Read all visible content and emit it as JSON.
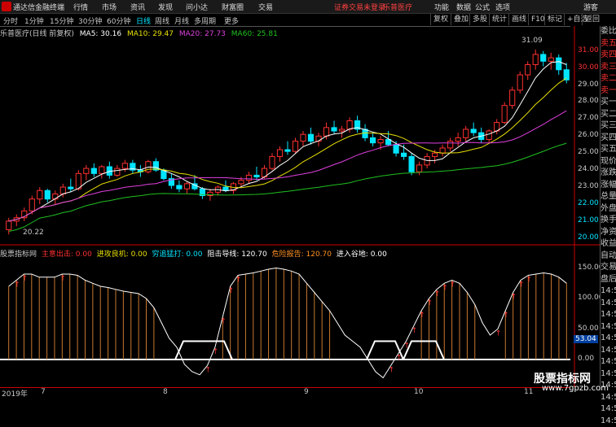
{
  "menubar": {
    "app": "通达信金融终端",
    "menus": [
      "行情",
      "市场",
      "资讯",
      "发现",
      "问小达",
      "财富圈",
      "交易"
    ],
    "notice": "证券交易未登录",
    "stock": "乐普医疗",
    "right": [
      "功能",
      "数据",
      "公式",
      "选项",
      "游客"
    ]
  },
  "period_tabs": [
    "分时",
    "1分钟",
    "15分钟",
    "30分钟",
    "60分钟",
    "日线",
    "周线",
    "月线",
    "多周期",
    "更多"
  ],
  "toolbar_buttons": [
    "复权",
    "叠加",
    "多股",
    "统计",
    "画线",
    "F10",
    "标记",
    "+自选",
    "返回"
  ],
  "ma_header": {
    "title": "乐普医疗(日线 前复权)",
    "ma5": "MA5: 30.16",
    "ma10": "MA10: 29.47",
    "ma20": "MA20: 27.73",
    "ma60": "MA60: 25.81"
  },
  "price_axis": [
    "31.00",
    "30.00",
    "29.00",
    "28.00",
    "27.00",
    "26.00",
    "25.00",
    "24.00",
    "23.00",
    "22.00",
    "21.00",
    "20.00"
  ],
  "price_annotations": {
    "high": "31.09",
    "low": "20.22"
  },
  "indicator_header": {
    "title": "股票指标网",
    "i1": "主意出击: 0.00",
    "i2": "进攻良机: 0.00",
    "i3": "穷追猛打: 0.00",
    "i4": "阻击导线: 120.70",
    "i5": "危险报告: 120.70",
    "i6": "进入谷地: 0.00"
  },
  "indicator_axis": [
    "150.00",
    "100.00",
    "50.00",
    "0.00"
  ],
  "indicator_current": "53.04",
  "side_panel": [
    "委比",
    "卖五",
    "卖四",
    "卖三",
    "卖二",
    "卖一",
    "买一",
    "买二",
    "买三",
    "买四",
    "买五",
    "现价",
    "涨跌",
    "涨幅",
    "总量",
    "外盘",
    "换手",
    "净资",
    "收益",
    "自动",
    "交易",
    "盘后",
    "14:56",
    "14:56",
    "14:56",
    "14:56",
    "14:56",
    "14:56",
    "14:56",
    "14:56",
    "14:57",
    "14:57",
    "14:57",
    "14:57"
  ],
  "date_axis": [
    "2019年",
    "7",
    "8",
    "9",
    "10",
    "11"
  ],
  "watermark": {
    "t1": "股票指标网",
    "t2": "www.7gpzb.com"
  },
  "colors": {
    "up": "#ff3030",
    "down": "#00e5ff",
    "ma5": "#ffffff",
    "ma10": "#e8e000",
    "ma20": "#e040e0",
    "ma60": "#20c020"
  },
  "chart_data": {
    "type": "candlestick",
    "ohlc": [
      [
        20.5,
        21.2,
        20.22,
        21.0
      ],
      [
        21.0,
        21.4,
        20.7,
        21.2
      ],
      [
        21.2,
        21.8,
        21.0,
        21.6
      ],
      [
        21.6,
        22.5,
        21.4,
        22.3
      ],
      [
        22.3,
        23.0,
        22.0,
        22.8
      ],
      [
        22.8,
        22.9,
        22.1,
        22.3
      ],
      [
        22.3,
        22.8,
        22.0,
        22.6
      ],
      [
        22.6,
        23.2,
        22.4,
        23.0
      ],
      [
        23.0,
        23.5,
        22.7,
        22.9
      ],
      [
        22.9,
        24.0,
        22.8,
        23.8
      ],
      [
        23.8,
        24.3,
        23.4,
        24.1
      ],
      [
        24.1,
        24.4,
        23.6,
        23.8
      ],
      [
        23.8,
        24.3,
        23.5,
        24.2
      ],
      [
        24.2,
        24.5,
        23.5,
        23.7
      ],
      [
        23.7,
        24.3,
        23.6,
        24.1
      ],
      [
        24.1,
        24.6,
        23.9,
        24.4
      ],
      [
        24.4,
        24.6,
        23.8,
        24.0
      ],
      [
        24.0,
        24.3,
        23.6,
        23.9
      ],
      [
        23.9,
        24.6,
        23.8,
        24.5
      ],
      [
        24.5,
        24.7,
        23.9,
        24.0
      ],
      [
        24.0,
        24.1,
        23.4,
        23.5
      ],
      [
        23.5,
        23.8,
        22.9,
        23.1
      ],
      [
        23.1,
        23.4,
        22.7,
        22.9
      ],
      [
        22.9,
        23.3,
        22.6,
        23.2
      ],
      [
        23.2,
        23.7,
        22.8,
        22.9
      ],
      [
        22.9,
        23.0,
        22.3,
        22.5
      ],
      [
        22.5,
        22.9,
        22.2,
        22.7
      ],
      [
        22.7,
        23.1,
        22.5,
        23.0
      ],
      [
        23.0,
        23.4,
        22.7,
        22.8
      ],
      [
        22.8,
        23.3,
        22.6,
        23.2
      ],
      [
        23.2,
        23.6,
        23.0,
        23.4
      ],
      [
        23.4,
        23.9,
        23.2,
        23.7
      ],
      [
        23.7,
        24.2,
        23.4,
        23.6
      ],
      [
        23.6,
        24.3,
        23.5,
        24.1
      ],
      [
        24.1,
        25.0,
        24.0,
        24.8
      ],
      [
        24.8,
        25.4,
        24.5,
        25.2
      ],
      [
        25.2,
        25.7,
        24.9,
        25.1
      ],
      [
        25.1,
        25.9,
        25.0,
        25.7
      ],
      [
        25.7,
        26.3,
        25.4,
        26.1
      ],
      [
        26.1,
        26.5,
        25.5,
        25.7
      ],
      [
        25.7,
        26.2,
        25.4,
        26.0
      ],
      [
        26.0,
        26.8,
        25.8,
        26.5
      ],
      [
        26.5,
        26.9,
        26.1,
        26.3
      ],
      [
        26.3,
        26.6,
        25.9,
        26.4
      ],
      [
        26.4,
        27.1,
        26.2,
        26.9
      ],
      [
        26.9,
        27.2,
        26.2,
        26.4
      ],
      [
        26.4,
        26.7,
        25.7,
        25.9
      ],
      [
        25.9,
        26.2,
        25.4,
        25.6
      ],
      [
        25.6,
        26.0,
        25.2,
        25.8
      ],
      [
        25.8,
        26.3,
        25.4,
        25.5
      ],
      [
        25.5,
        25.7,
        24.8,
        25.0
      ],
      [
        25.0,
        25.5,
        24.6,
        24.8
      ],
      [
        24.8,
        25.0,
        23.7,
        23.9
      ],
      [
        23.9,
        24.5,
        23.7,
        24.3
      ],
      [
        24.3,
        25.0,
        24.1,
        24.8
      ],
      [
        24.8,
        25.2,
        24.4,
        25.0
      ],
      [
        25.0,
        25.5,
        24.8,
        25.3
      ],
      [
        25.3,
        25.9,
        25.1,
        25.7
      ],
      [
        25.7,
        26.2,
        25.4,
        25.9
      ],
      [
        25.9,
        26.6,
        25.7,
        26.4
      ],
      [
        26.4,
        26.8,
        26.0,
        26.2
      ],
      [
        26.2,
        26.5,
        25.6,
        25.8
      ],
      [
        25.8,
        26.4,
        25.6,
        26.3
      ],
      [
        26.3,
        27.0,
        26.1,
        26.8
      ],
      [
        26.8,
        28.0,
        26.7,
        27.8
      ],
      [
        27.8,
        28.9,
        27.6,
        28.7
      ],
      [
        28.7,
        29.8,
        28.5,
        29.6
      ],
      [
        29.6,
        30.4,
        29.3,
        30.2
      ],
      [
        30.2,
        31.09,
        29.9,
        30.8
      ],
      [
        30.8,
        31.0,
        30.1,
        30.4
      ],
      [
        30.4,
        30.9,
        29.9,
        30.6
      ],
      [
        30.6,
        30.8,
        29.6,
        29.9
      ],
      [
        29.9,
        30.3,
        29.1,
        29.3
      ]
    ],
    "ma5": [
      30.16
    ],
    "ma10": [
      29.47
    ],
    "ma20": [
      27.73
    ],
    "ma60": [
      25.81
    ],
    "indicator": [
      120,
      130,
      140,
      140,
      135,
      135,
      135,
      140,
      140,
      138,
      130,
      125,
      120,
      118,
      115,
      112,
      110,
      108,
      100,
      85,
      60,
      35,
      20,
      -8,
      -20,
      -25,
      -10,
      20,
      70,
      120,
      138,
      140,
      142,
      145,
      148,
      150,
      148,
      145,
      140,
      125,
      110,
      95,
      80,
      60,
      40,
      30,
      20,
      0,
      -20,
      -30,
      -10,
      10,
      30,
      55,
      80,
      100,
      115,
      125,
      130,
      125,
      110,
      90,
      60,
      40,
      50,
      80,
      110,
      130,
      138,
      140,
      142,
      140,
      135,
      125
    ],
    "ylim_price": [
      19.8,
      31.8
    ],
    "ylim_indicator": [
      -40,
      160
    ]
  }
}
